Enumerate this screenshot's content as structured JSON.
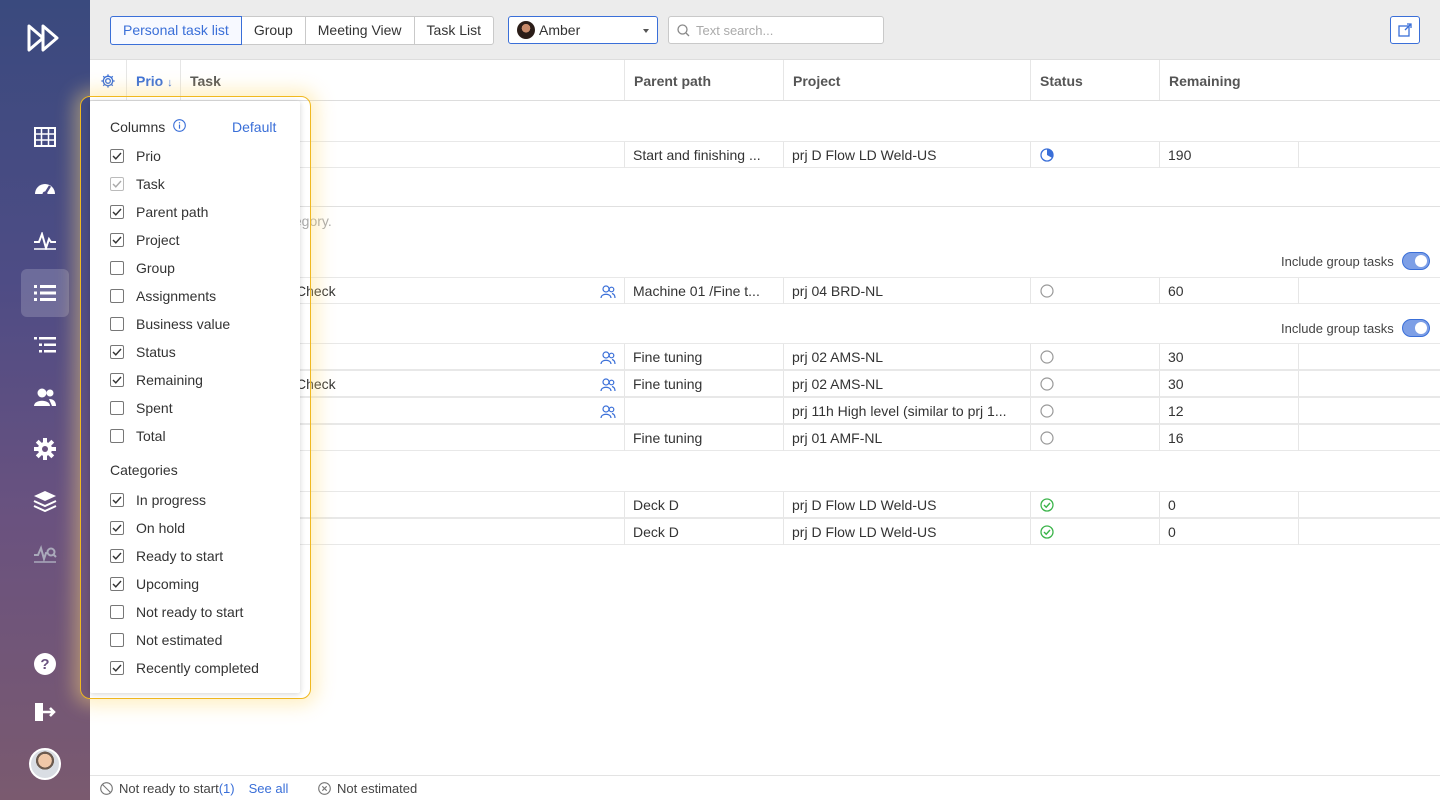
{
  "sidebar": {
    "icons": [
      "fast-forward-logo-icon",
      "calendar-grid-icon",
      "dashboard-gauge-icon",
      "activity-pulse-icon",
      "task-list-icon",
      "indented-list-icon",
      "users-icon",
      "gear-icon",
      "layers-icon",
      "report-search-icon",
      "help-icon",
      "logout-icon"
    ],
    "active": "task-list-icon"
  },
  "topbar": {
    "tabs": [
      {
        "label": "Personal task list",
        "active": true
      },
      {
        "label": "Group"
      },
      {
        "label": "Meeting View"
      },
      {
        "label": "Task List"
      }
    ],
    "user": "Amber",
    "search_placeholder": "Text search..."
  },
  "columns": {
    "prio": "Prio",
    "prio_sort": "↓",
    "task": "Task",
    "parent_path": "Parent path",
    "project": "Project",
    "status": "Status",
    "remaining": "Remaining"
  },
  "hint_text": "tegory.",
  "include_group_tasks": "Include group tasks",
  "rows": [
    {
      "task": "",
      "parent": "Start and finishing ...",
      "project": "prj D Flow LD Weld-US",
      "status": "in-progress",
      "remaining": "190",
      "group": false
    },
    {
      "task": "Check",
      "parent": "Machine 01 /Fine t...",
      "project": "prj 04 BRD-NL",
      "status": "not-started",
      "remaining": "60",
      "group": true
    },
    {
      "task": "",
      "parent": "Fine tuning",
      "project": "prj 02 AMS-NL",
      "status": "not-started",
      "remaining": "30",
      "group": true
    },
    {
      "task": "Check",
      "parent": "Fine tuning",
      "project": "prj 02 AMS-NL",
      "status": "not-started",
      "remaining": "30",
      "group": true
    },
    {
      "task": "",
      "parent": "",
      "project": "prj 11h High level (similar to prj 1...",
      "status": "not-started",
      "remaining": "12",
      "group": true
    },
    {
      "task": "",
      "parent": "Fine tuning",
      "project": "prj 01 AMF-NL",
      "status": "not-started",
      "remaining": "16",
      "group": false
    },
    {
      "task": "",
      "parent": "Deck D",
      "project": "prj D Flow LD Weld-US",
      "status": "done",
      "remaining": "0",
      "group": false
    },
    {
      "task": "",
      "parent": "Deck D",
      "project": "prj D Flow LD Weld-US",
      "status": "done",
      "remaining": "0",
      "group": false
    }
  ],
  "popover": {
    "columns_title": "Columns",
    "default_label": "Default",
    "columns": [
      {
        "label": "Prio",
        "checked": true
      },
      {
        "label": "Task",
        "checked": true,
        "disabled": true
      },
      {
        "label": "Parent path",
        "checked": true
      },
      {
        "label": "Project",
        "checked": true
      },
      {
        "label": "Group",
        "checked": false
      },
      {
        "label": "Assignments",
        "checked": false
      },
      {
        "label": "Business value",
        "checked": false
      },
      {
        "label": "Status",
        "checked": true
      },
      {
        "label": "Remaining",
        "checked": true
      },
      {
        "label": "Spent",
        "checked": false
      },
      {
        "label": "Total",
        "checked": false
      }
    ],
    "categories_title": "Categories",
    "categories": [
      {
        "label": "In progress",
        "checked": true
      },
      {
        "label": "On hold",
        "checked": true
      },
      {
        "label": "Ready to start",
        "checked": true
      },
      {
        "label": "Upcoming",
        "checked": true
      },
      {
        "label": "Not ready to start",
        "checked": false
      },
      {
        "label": "Not estimated",
        "checked": false
      },
      {
        "label": "Recently completed",
        "checked": true
      }
    ]
  },
  "footer": {
    "not_ready": "Not ready to start",
    "not_ready_count": "(1)",
    "see_all": "See all",
    "not_estimated": "Not estimated"
  },
  "colors": {
    "accent": "#3a6fd8",
    "success": "#3bb44a",
    "highlight": "#f0b820"
  }
}
